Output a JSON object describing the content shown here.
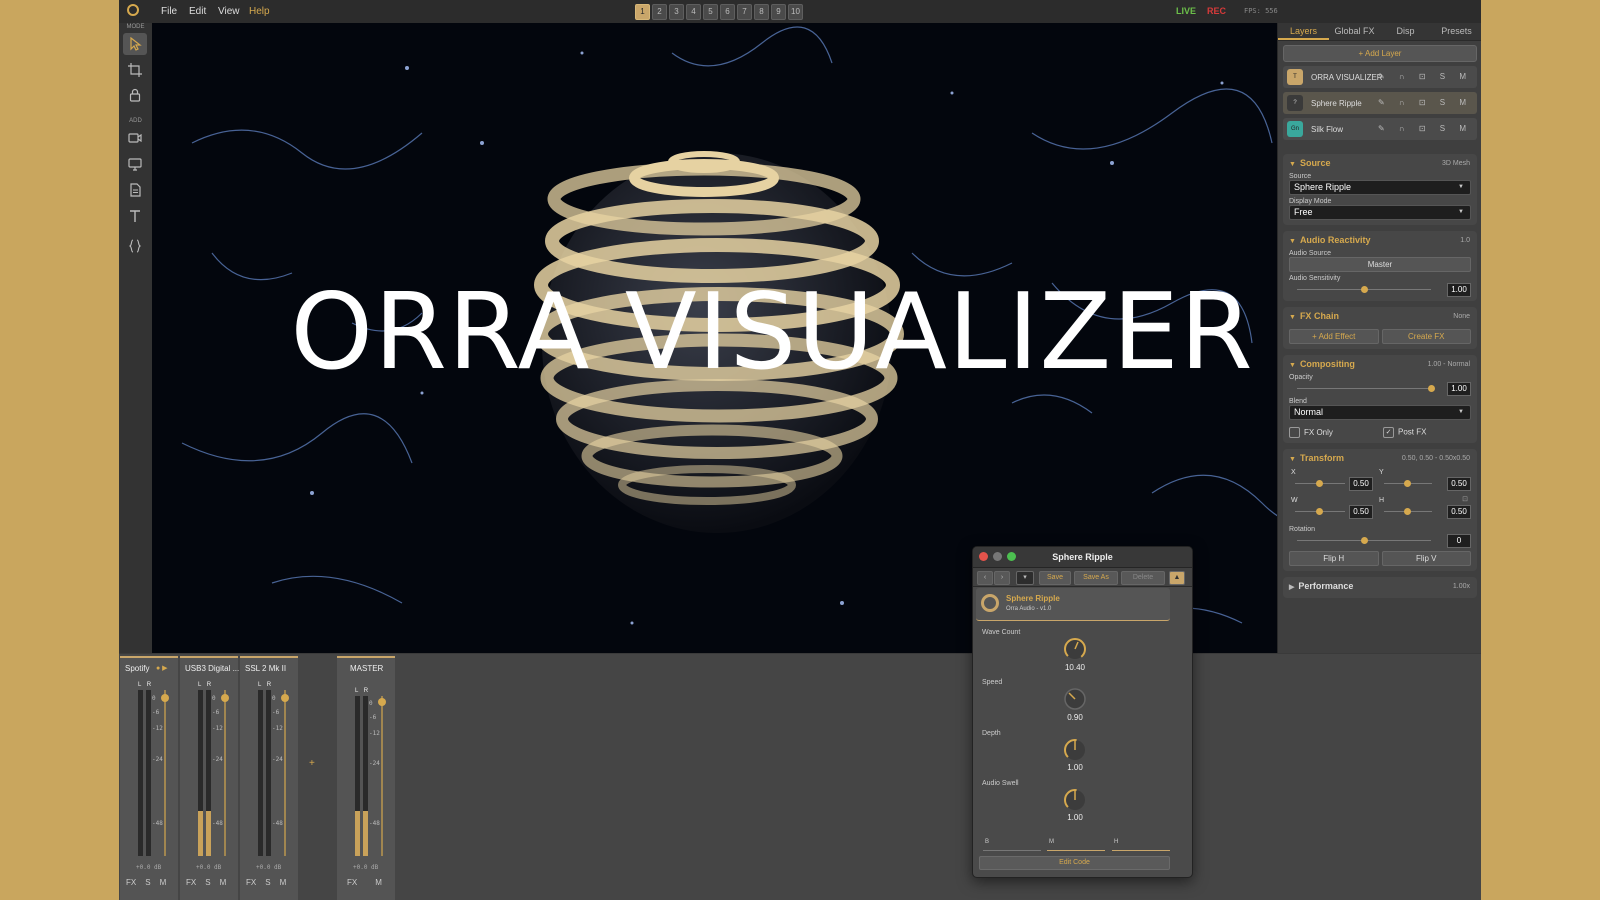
{
  "menu": {
    "file": "File",
    "edit": "Edit",
    "view": "View",
    "help": "Help"
  },
  "presets": [
    "1",
    "2",
    "3",
    "4",
    "5",
    "6",
    "7",
    "8",
    "9",
    "10"
  ],
  "status": {
    "live": "LIVE",
    "rec": "REC",
    "fps": "FPS: 556"
  },
  "toolbar": {
    "mode_label": "MODE",
    "add_label": "ADD"
  },
  "viewport": {
    "title_text": "ORRA VISUALIZER"
  },
  "right_tabs": [
    "Layers",
    "Global FX",
    "Disp",
    "Presets"
  ],
  "add_layer": "+ Add Layer",
  "layers": [
    {
      "badge": "T",
      "name": "ORRA VISUALIZER",
      "badge_color": "#c9a66a",
      "icons": "✎ ∩ ⊡ S M"
    },
    {
      "badge": "?",
      "name": "Sphere Ripple",
      "badge_color": "#5a5a5a",
      "icons": "✎ ∩ ⊡ S M"
    },
    {
      "badge": "Gn",
      "name": "Silk Flow",
      "badge_color": "#3aa89c",
      "icons": "✎ ∩ ⊡ S M"
    }
  ],
  "source": {
    "title": "Source",
    "value": "3D Mesh",
    "source_label": "Source",
    "source_value": "Sphere Ripple",
    "display_mode_label": "Display Mode",
    "display_mode_value": "Free"
  },
  "audio": {
    "title": "Audio Reactivity",
    "value": "1.0",
    "source_label": "Audio Source",
    "source_value": "Master",
    "sens_label": "Audio Sensitivity",
    "sens_value": "1.00"
  },
  "fx_chain": {
    "title": "FX Chain",
    "value": "None",
    "add_effect": "+ Add Effect",
    "create_fx": "Create FX"
  },
  "compositing": {
    "title": "Compositing",
    "value": "1.00 - Normal",
    "opacity_label": "Opacity",
    "opacity_value": "1.00",
    "blend_label": "Blend",
    "blend_value": "Normal",
    "fx_only": "FX Only",
    "post_fx": "Post FX"
  },
  "transform": {
    "title": "Transform",
    "value": "0.50, 0.50 - 0.50x0.50",
    "x_label": "X",
    "y_label": "Y",
    "x_value": "0.50",
    "y_value": "0.50",
    "w_label": "W",
    "h_label": "H",
    "w_value": "0.50",
    "h_value": "0.50",
    "rot_label": "Rotation",
    "rot_value": "0",
    "flip_h": "Flip H",
    "flip_v": "Flip V"
  },
  "performance": {
    "title": "Performance",
    "value": "1.00x"
  },
  "mixer": {
    "channels": [
      {
        "name": "Spotify",
        "db": "+0.0 dB",
        "level": 0.0
      },
      {
        "name": "USB3 Digital ...",
        "db": "+0.0 dB",
        "level": 0.27
      },
      {
        "name": "SSL 2 Mk II",
        "db": "+0.0 dB",
        "level": 0.0
      }
    ],
    "master": {
      "name": "MASTER",
      "db": "+0.0 dB",
      "level": 0.27
    },
    "lr": "L R",
    "ticks": [
      "0",
      "-6",
      "-12",
      "-24",
      "-48"
    ],
    "fx": "FX",
    "s": "S",
    "m": "M",
    "add": "+"
  },
  "plugin": {
    "title": "Sphere Ripple",
    "save": "Save",
    "save_as": "Save As",
    "delete": "Delete",
    "name": "Sphere Ripple",
    "sub": "Orra Audio - v1.0",
    "params": [
      {
        "label": "Wave Count",
        "value": "10.40"
      },
      {
        "label": "Speed",
        "value": "0.90"
      },
      {
        "label": "Depth",
        "value": "1.00"
      },
      {
        "label": "Audio Swell",
        "value": "1.00"
      }
    ],
    "b": "B",
    "m": "M",
    "h": "H",
    "edit_code": "Edit Code"
  },
  "colors": {
    "accent": "#d6a94e",
    "live": "#6cc04a",
    "rec": "#d63a3a"
  }
}
